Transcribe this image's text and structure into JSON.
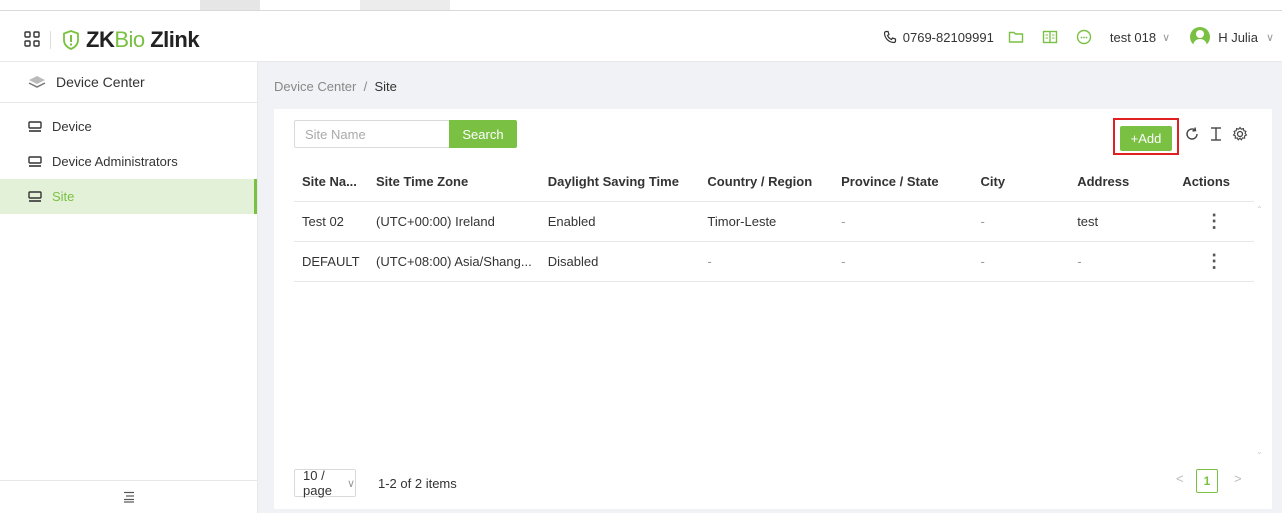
{
  "header": {
    "brand_main": "ZK",
    "brand_bio": "Bio",
    "brand_suffix": " Zlink",
    "phone": "0769-82109991",
    "org": "test 018",
    "user": "H Julia",
    "icons": [
      "apps-grid-icon",
      "phone-icon",
      "folder-icon",
      "book-icon",
      "chat-icon"
    ]
  },
  "sidebar": {
    "title": "Device Center",
    "items": [
      {
        "label": "Device",
        "active": false
      },
      {
        "label": "Device Administrators",
        "active": false
      },
      {
        "label": "Site",
        "active": true
      }
    ]
  },
  "breadcrumb": {
    "parent": "Device Center",
    "separator": "/",
    "current": "Site"
  },
  "toolbar": {
    "search_placeholder": "Site Name",
    "search_label": "Search",
    "add_label": "+Add"
  },
  "table": {
    "columns": [
      "Site Na...",
      "Site Time Zone",
      "Daylight Saving Time",
      "Country / Region",
      "Province / State",
      "City",
      "Address",
      "Actions"
    ],
    "rows": [
      [
        "Test 02",
        "(UTC+00:00) Ireland",
        "Enabled",
        "Timor-Leste",
        "-",
        "-",
        "test",
        "⋮"
      ],
      [
        "DEFAULT",
        "(UTC+08:00) Asia/Shang...",
        "Disabled",
        "-",
        "-",
        "-",
        "-",
        "⋮"
      ]
    ]
  },
  "pagination": {
    "page_size": "10 / page",
    "total": "1-2 of 2 items",
    "current_page": "1"
  },
  "colors": {
    "accent": "#7ac143",
    "highlight_border": "#e02020"
  }
}
